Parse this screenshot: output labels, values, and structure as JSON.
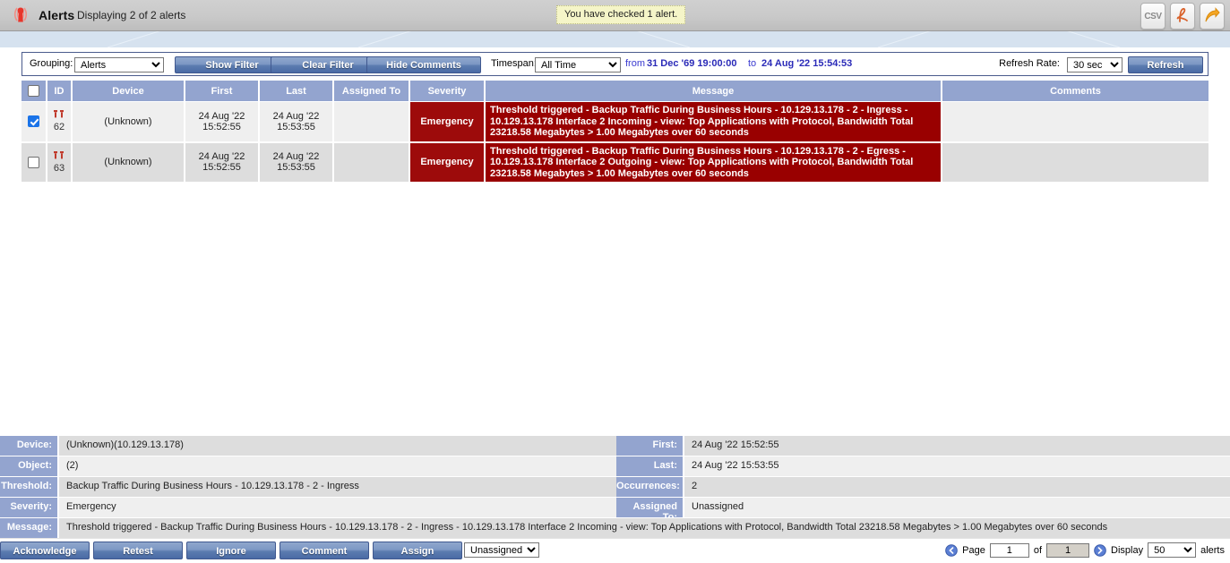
{
  "header": {
    "icon": "alert-siren-icon",
    "title": "Alerts",
    "subtitle": "Displaying 2 of 2 alerts",
    "notice": "You have checked 1 alert.",
    "buttons": [
      {
        "name": "csv-export-button",
        "label": "CSV"
      },
      {
        "name": "pdf-export-button",
        "label": ""
      },
      {
        "name": "share-export-button",
        "label": ""
      }
    ]
  },
  "toolbar": {
    "grouping_label": "Grouping:",
    "grouping_value": "Alerts",
    "grouping_options": [
      "Alerts"
    ],
    "show_filter": "Show Filter",
    "clear_filter": "Clear Filter",
    "hide_comments": "Hide Comments",
    "timespan_label": "Timespan:",
    "timespan_value": "All Time",
    "timespan_options": [
      "All Time"
    ],
    "from_word": "from",
    "from_date": "31 Dec '69 19:00:00",
    "to_word": "to",
    "to_date": "24 Aug '22 15:54:53",
    "refresh_label": "Refresh Rate:",
    "refresh_value": "30 sec",
    "refresh_options": [
      "30 sec"
    ],
    "refresh_button": "Refresh"
  },
  "table": {
    "columns": [
      "",
      "ID",
      "Device",
      "First",
      "Last",
      "Assigned To",
      "Severity",
      "Message",
      "Comments"
    ],
    "rows": [
      {
        "checked": true,
        "id": "62",
        "device": "(Unknown)",
        "first_date": "24 Aug '22",
        "first_time": "15:52:55",
        "last_date": "24 Aug '22",
        "last_time": "15:53:55",
        "assigned_to": "",
        "severity": "Emergency",
        "message": "Threshold triggered - Backup Traffic During Business Hours - 10.129.13.178 - 2 - Ingress - 10.129.13.178 Interface 2 Incoming - view: Top Applications with Protocol, Bandwidth Total 23218.58 Megabytes > 1.00 Megabytes over 60 seconds",
        "comments": ""
      },
      {
        "checked": false,
        "id": "63",
        "device": "(Unknown)",
        "first_date": "24 Aug '22",
        "first_time": "15:52:55",
        "last_date": "24 Aug '22",
        "last_time": "15:53:55",
        "assigned_to": "",
        "severity": "Emergency",
        "message": "Threshold triggered - Backup Traffic During Business Hours - 10.129.13.178 - 2 - Egress - 10.129.13.178 Interface 2 Outgoing - view: Top Applications with Protocol, Bandwidth Total 23218.58 Megabytes > 1.00 Megabytes over 60 seconds",
        "comments": ""
      }
    ]
  },
  "details": {
    "device_label": "Device:",
    "device_value": "(Unknown)(10.129.13.178)",
    "object_label": "Object:",
    "object_value": "(2)",
    "threshold_label": "Threshold:",
    "threshold_value": "Backup Traffic During Business Hours - 10.129.13.178 - 2 - Ingress",
    "severity_label": "Severity:",
    "severity_value": "Emergency",
    "message_label": "Message:",
    "message_value": "Threshold triggered - Backup Traffic During Business Hours - 10.129.13.178 - 2 - Ingress - 10.129.13.178 Interface 2 Incoming - view: Top Applications with Protocol, Bandwidth Total 23218.58 Megabytes > 1.00 Megabytes over 60 seconds",
    "first_label": "First:",
    "first_value": "24 Aug '22 15:52:55",
    "last_label": "Last:",
    "last_value": "24 Aug '22 15:53:55",
    "occurrences_label": "Occurrences:",
    "occurrences_value": "2",
    "assigned_label": "Assigned To:",
    "assigned_value": "Unassigned"
  },
  "footer": {
    "acknowledge": "Acknowledge",
    "retest": "Retest",
    "ignore": "Ignore",
    "comment": "Comment",
    "assign": "Assign",
    "assignee_value": "Unassigned",
    "assignee_options": [
      "Unassigned"
    ],
    "page_label": "Page",
    "page_value": "1",
    "of_label": "of",
    "page_total": "1",
    "display_label": "Display",
    "display_value": "50",
    "display_options": [
      "50"
    ],
    "alerts_label": "alerts"
  },
  "colors": {
    "header_blue": "#93a4cf",
    "emergency_red": "#990000",
    "accent_button": "#4a6ba5",
    "link_blue": "#2a2ab8",
    "notice_yellow": "#f5f5c8"
  }
}
